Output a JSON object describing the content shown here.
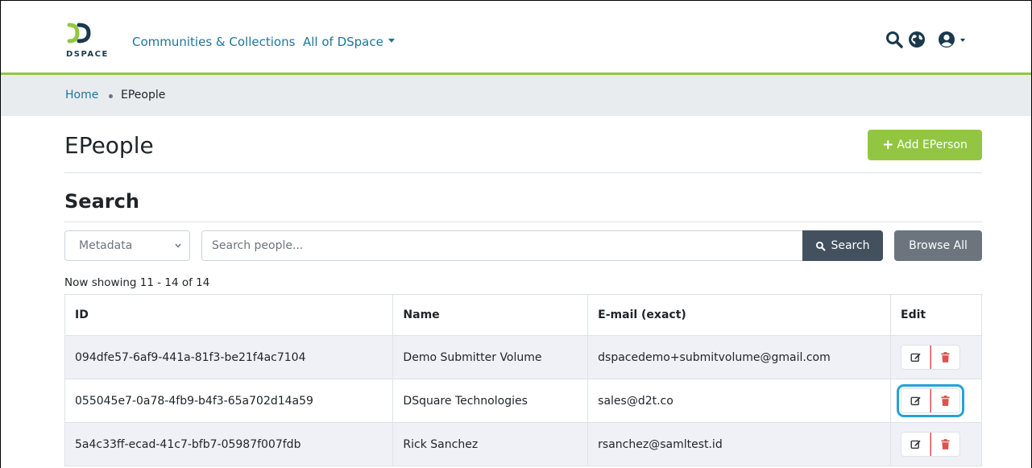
{
  "header": {
    "logo_text": "DSPACE",
    "nav_communities": "Communities & Collections",
    "nav_all": "All of DSpace"
  },
  "breadcrumb": {
    "home": "Home",
    "current": "EPeople"
  },
  "page": {
    "title": "EPeople",
    "add_button": "Add EPerson",
    "section_title": "Search"
  },
  "search": {
    "scope_value": "Metadata",
    "placeholder": "Search people...",
    "search_button": "Search",
    "browse_button": "Browse All"
  },
  "results": {
    "showing": "Now showing 11 - 14 of 14"
  },
  "table": {
    "headers": {
      "id": "ID",
      "name": "Name",
      "email": "E-mail (exact)",
      "edit": "Edit"
    },
    "rows": [
      {
        "id": "094dfe57-6af9-441a-81f3-be21f4ac7104",
        "name": "Demo Submitter Volume",
        "email": "dspacedemo+submitvolume@gmail.com"
      },
      {
        "id": "055045e7-0a78-4fb9-b4f3-65a702d14a59",
        "name": "DSquare Technologies",
        "email": "sales@d2t.co"
      },
      {
        "id": "5a4c33ff-ecad-41c7-bfb7-05987f007fdb",
        "name": "Rick Sanchez",
        "email": "rsanchez@samltest.id"
      }
    ]
  },
  "colors": {
    "brand_green": "#92c642",
    "link_blue": "#207698",
    "search_dark": "#43515f",
    "browse_gray": "#6c757d",
    "delete_red": "#d9534f",
    "focus_ring": "#25a2d8"
  },
  "icons": {
    "logo": "dspace-logo",
    "search": "search-icon",
    "globe": "globe-icon",
    "user": "user-circle-icon",
    "plus": "plus-icon",
    "edit": "edit-icon",
    "delete": "trash-icon"
  }
}
